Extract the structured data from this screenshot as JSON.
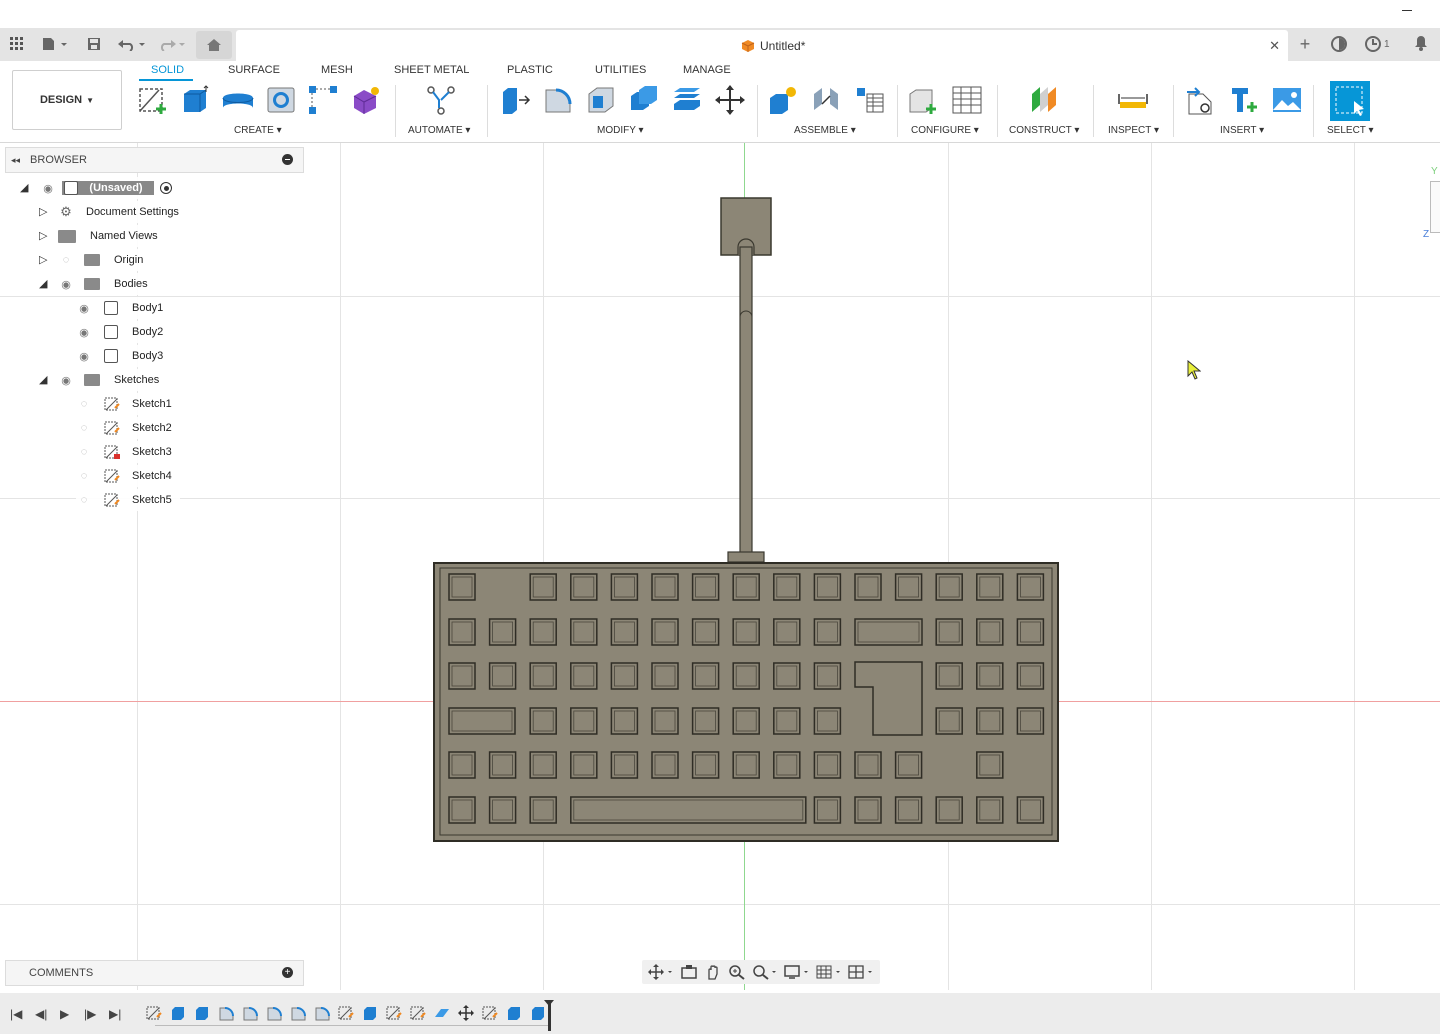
{
  "app": {
    "doc_title": "Untitled*",
    "notifications_count": "1"
  },
  "toolbar": {
    "workspace_label": "DESIGN",
    "tabs": [
      {
        "label": "SOLID",
        "active": true
      },
      {
        "label": "SURFACE"
      },
      {
        "label": "MESH"
      },
      {
        "label": "SHEET METAL"
      },
      {
        "label": "PLASTIC"
      },
      {
        "label": "UTILITIES"
      },
      {
        "label": "MANAGE"
      }
    ],
    "groups": {
      "create": "CREATE",
      "automate": "AUTOMATE",
      "modify": "MODIFY",
      "assemble": "ASSEMBLE",
      "configure": "CONFIGURE",
      "construct": "CONSTRUCT",
      "inspect": "INSPECT",
      "insert": "INSERT",
      "select": "SELECT"
    }
  },
  "browser": {
    "title": "BROWSER",
    "root": "(Unsaved)",
    "items": {
      "document_settings": "Document Settings",
      "named_views": "Named Views",
      "origin": "Origin",
      "bodies": "Bodies",
      "sketches": "Sketches"
    },
    "bodies": [
      "Body1",
      "Body2",
      "Body3"
    ],
    "sketches": [
      "Sketch1",
      "Sketch2",
      "Sketch3",
      "Sketch4",
      "Sketch5"
    ]
  },
  "comments": {
    "title": "COMMENTS"
  },
  "viewcube": {
    "y_label": "Y",
    "z_label": "Z"
  },
  "colors": {
    "accent": "#0696d7",
    "model": "#8c8676",
    "model_dark": "#3a382f",
    "grid": "#e4e4e4"
  }
}
